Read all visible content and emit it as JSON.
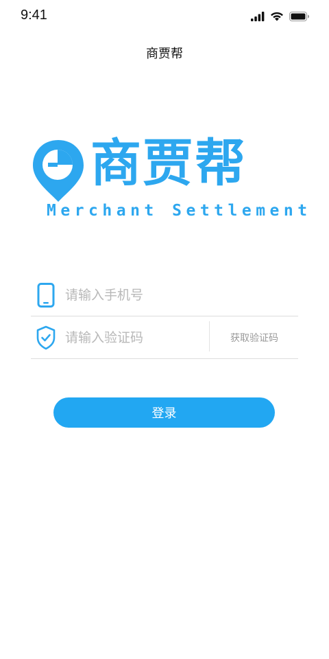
{
  "status_bar": {
    "time": "9:41"
  },
  "nav": {
    "title": "商贾帮"
  },
  "logo": {
    "chinese": "商贾帮",
    "english": "Merchant Settlement",
    "color": "#2da7ef"
  },
  "form": {
    "phone": {
      "placeholder": "请输入手机号",
      "value": "",
      "icon": "phone-icon"
    },
    "code": {
      "placeholder": "请输入验证码",
      "value": "",
      "icon": "shield-check-icon",
      "get_code_label": "获取验证码"
    },
    "login_label": "登录"
  },
  "colors": {
    "accent": "#22a7f2",
    "divider": "#dcdcdc",
    "placeholder": "#b8b8b8"
  }
}
